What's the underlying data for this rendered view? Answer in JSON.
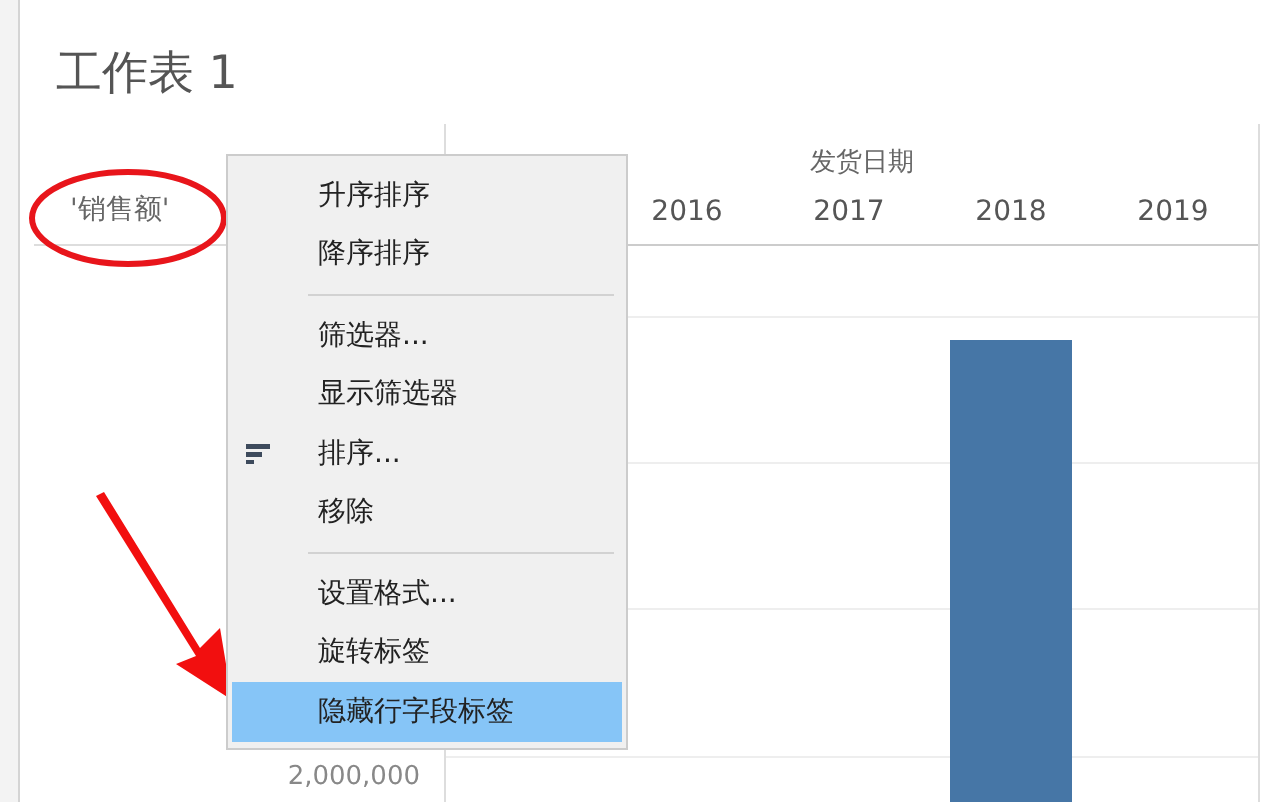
{
  "sheet_title": "工作表 1",
  "row_field_label": "'销售额'",
  "column_field_label": "发货日期",
  "column_headers": [
    {
      "label": "2016",
      "bar": false
    },
    {
      "label": "2017",
      "bar": false
    },
    {
      "label": "2018",
      "bar": true
    },
    {
      "label": "2019",
      "bar": false
    }
  ],
  "axis_label": "2,000,000",
  "context_menu": {
    "groups": [
      [
        {
          "label": "升序排序",
          "kind": "plain",
          "selected": false
        },
        {
          "label": "降序排序",
          "kind": "plain",
          "selected": false
        }
      ],
      [
        {
          "label": "筛选器...",
          "kind": "plain",
          "selected": false
        },
        {
          "label": "显示筛选器",
          "kind": "plain",
          "selected": false
        },
        {
          "label": "排序...",
          "kind": "sort",
          "selected": false
        },
        {
          "label": "移除",
          "kind": "plain",
          "selected": false
        }
      ],
      [
        {
          "label": "设置格式...",
          "kind": "plain",
          "selected": false
        },
        {
          "label": "旋转标签",
          "kind": "plain",
          "selected": false
        },
        {
          "label": "隐藏行字段标签",
          "kind": "plain",
          "selected": true
        }
      ]
    ]
  }
}
